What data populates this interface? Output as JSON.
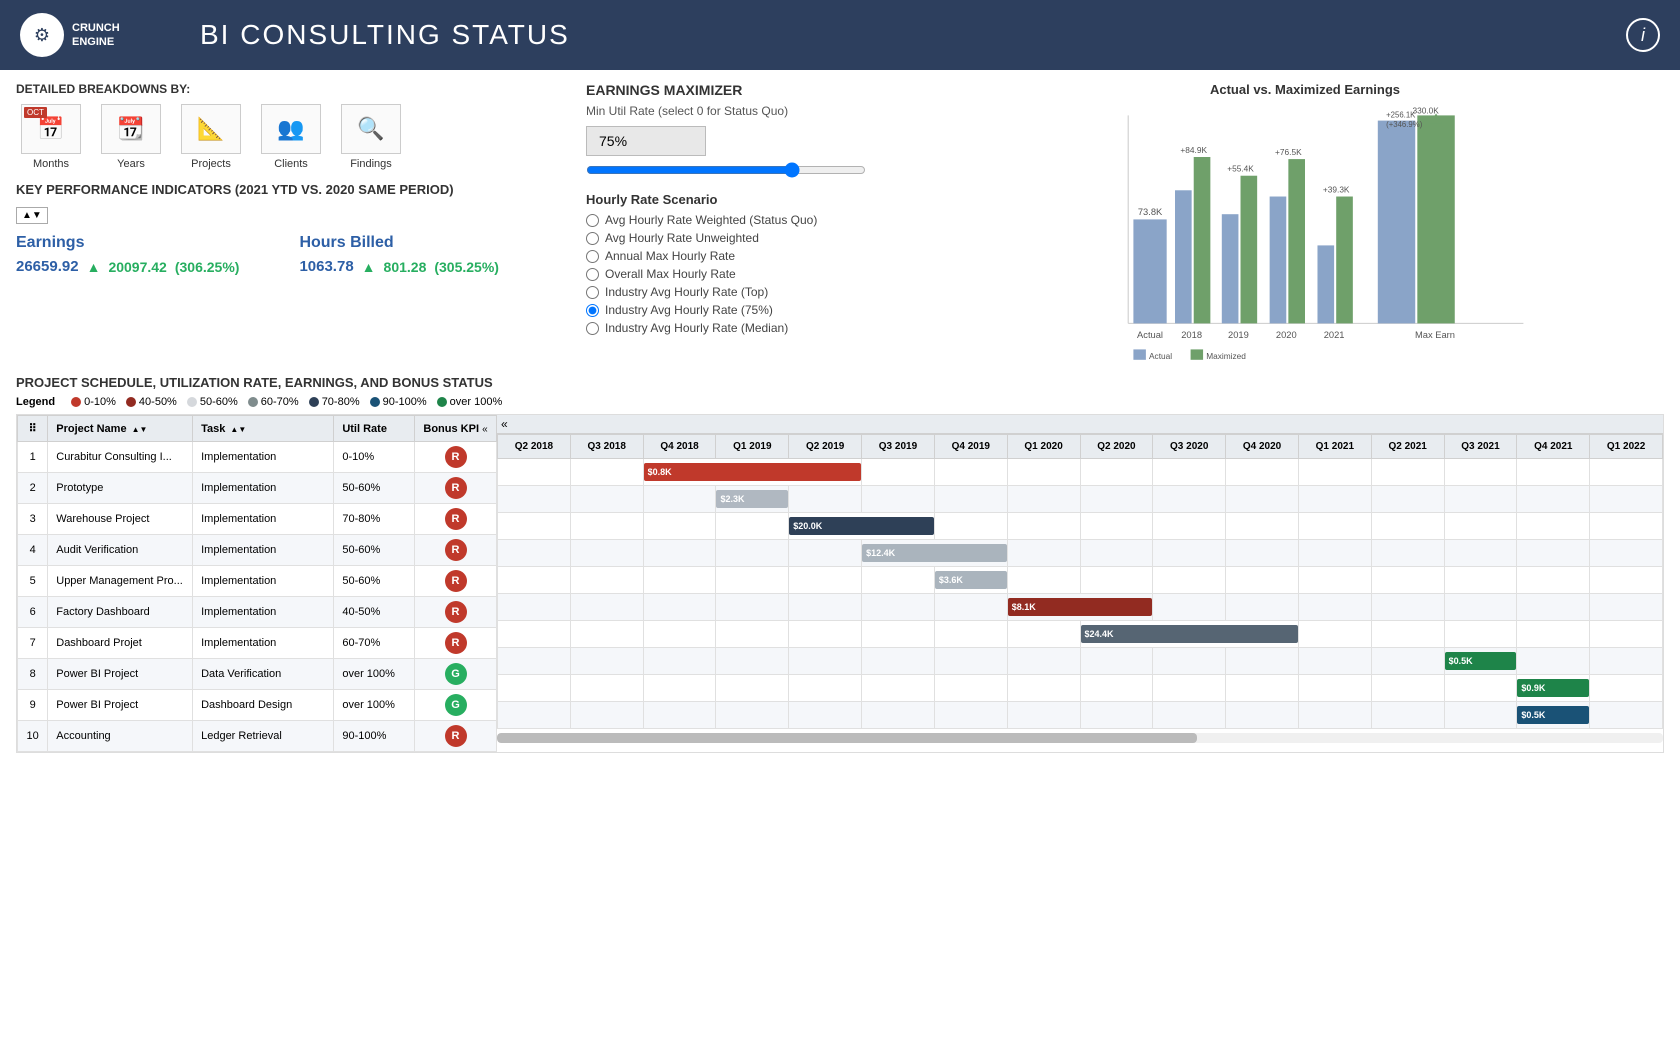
{
  "header": {
    "title": "BI CONSULTING STATUS",
    "logo_text": "CRUNCH\nENGINE",
    "info_icon": "i"
  },
  "breakdowns": {
    "label": "DETAILED BREAKDOWNS BY:",
    "items": [
      {
        "id": "months",
        "label": "Months",
        "badge": "OCT",
        "icon": "📅"
      },
      {
        "id": "years",
        "label": "Years",
        "icon": "📆"
      },
      {
        "id": "projects",
        "label": "Projects",
        "icon": "📐"
      },
      {
        "id": "clients",
        "label": "Clients",
        "icon": "👥"
      },
      {
        "id": "findings",
        "label": "Findings",
        "icon": "🔍"
      }
    ]
  },
  "kpi": {
    "title": "KEY PERFORMANCE INDICATORS (2021 YTD VS. 2020 SAME PERIOD)",
    "earnings": {
      "label": "Earnings",
      "main": "26659.92",
      "change": "20097.42",
      "pct": "(306.25%)"
    },
    "hours": {
      "label": "Hours Billed",
      "main": "1063.78",
      "change": "801.28",
      "pct": "(305.25%)"
    }
  },
  "maximizer": {
    "title": "EARNINGS MAXIMIZER",
    "subtitle": "Min Util Rate (select 0 for Status Quo)",
    "rate_value": "75%",
    "hourly_title": "Hourly Rate Scenario",
    "options": [
      {
        "label": "Avg Hourly Rate Weighted (Status Quo)",
        "checked": false
      },
      {
        "label": "Avg Hourly Rate Unweighted",
        "checked": false
      },
      {
        "label": "Annual Max Hourly Rate",
        "checked": false
      },
      {
        "label": "Overall Max Hourly Rate",
        "checked": false
      },
      {
        "label": "Industry Avg Hourly Rate (Top)",
        "checked": false
      },
      {
        "label": "Industry Avg Hourly Rate (75%)",
        "checked": true
      },
      {
        "label": "Industry Avg Hourly Rate (Median)",
        "checked": false
      }
    ]
  },
  "chart": {
    "title": "Actual vs. Maximized Earnings",
    "bars": [
      {
        "label": "Actual",
        "actual": 73.8,
        "max": null,
        "actual_label": "73.8K",
        "max_label": null,
        "diff": null
      },
      {
        "label": "2018",
        "actual": 84.9,
        "max": 84.9,
        "actual_label": "84.9K",
        "max_label": "+84.9K",
        "diff": null
      },
      {
        "label": "2019",
        "actual": 55.4,
        "max": 55.4,
        "actual_label": "55.4K",
        "max_label": "+55.4K",
        "diff": null
      },
      {
        "label": "2020",
        "actual": 76.5,
        "max": 76.5,
        "actual_label": "76.5K",
        "max_label": "+76.5K",
        "diff": null
      },
      {
        "label": "2021",
        "actual": 39.3,
        "max": 39.3,
        "actual_label": "39.3K",
        "max_label": "+39.3K",
        "diff": null
      },
      {
        "label": "Max Earn",
        "actual": 256.1,
        "max": 330.0,
        "actual_label": "256.1K (+346.9%)",
        "max_label": "330.0K",
        "diff": null
      }
    ]
  },
  "schedule": {
    "title": "PROJECT SCHEDULE, UTILIZATION RATE, EARNINGS, AND BONUS STATUS",
    "legend_items": [
      {
        "label": "0-10%",
        "color": "#c0392b"
      },
      {
        "label": "40-50%",
        "color": "#922b21"
      },
      {
        "label": "50-60%",
        "color": "#d5d8dc"
      },
      {
        "label": "60-70%",
        "color": "#7f8c8d"
      },
      {
        "label": "70-80%",
        "color": "#2e4057"
      },
      {
        "label": "90-100%",
        "color": "#1a5276"
      },
      {
        "label": "over 100%",
        "color": "#1e8449"
      }
    ],
    "columns": {
      "num": "#",
      "project": "Project Name",
      "task": "Task",
      "util": "Util Rate",
      "bonus": "Bonus KPI"
    },
    "rows": [
      {
        "num": 1,
        "project": "Curabitur Consulting I...",
        "task": "Implementation",
        "util": "0-10%",
        "bonus": "R",
        "gantt_col": 2,
        "gantt_width": 3,
        "gantt_color": "#c0392b",
        "gantt_label": "$0.8K"
      },
      {
        "num": 2,
        "project": "Prototype",
        "task": "Implementation",
        "util": "50-60%",
        "bonus": "R",
        "gantt_col": 3,
        "gantt_width": 1,
        "gantt_color": "#b0b8c1",
        "gantt_label": "$2.3K"
      },
      {
        "num": 3,
        "project": "Warehouse Project",
        "task": "Implementation",
        "util": "70-80%",
        "bonus": "R",
        "gantt_col": 4,
        "gantt_width": 2,
        "gantt_color": "#2e4057",
        "gantt_label": "$20.0K"
      },
      {
        "num": 4,
        "project": "Audit Verification",
        "task": "Implementation",
        "util": "50-60%",
        "bonus": "R",
        "gantt_col": 5,
        "gantt_width": 2,
        "gantt_color": "#aab4bd",
        "gantt_label": "$12.4K"
      },
      {
        "num": 5,
        "project": "Upper Management Pro...",
        "task": "Implementation",
        "util": "50-60%",
        "bonus": "R",
        "gantt_col": 6,
        "gantt_width": 1,
        "gantt_color": "#aab4bd",
        "gantt_label": "$3.6K"
      },
      {
        "num": 6,
        "project": "Factory Dashboard",
        "task": "Implementation",
        "util": "40-50%",
        "bonus": "R",
        "gantt_col": 7,
        "gantt_width": 2,
        "gantt_color": "#922b21",
        "gantt_label": "$8.1K"
      },
      {
        "num": 7,
        "project": "Dashboard Projet",
        "task": "Implementation",
        "util": "60-70%",
        "bonus": "R",
        "gantt_col": 8,
        "gantt_width": 3,
        "gantt_color": "#566573",
        "gantt_label": "$24.4K"
      },
      {
        "num": 8,
        "project": "Power BI Project",
        "task": "Data Verification",
        "util": "over 100%",
        "bonus": "G",
        "gantt_col": 9,
        "gantt_width": 1,
        "gantt_color": "#1e8449",
        "gantt_label": "$0.5K"
      },
      {
        "num": 9,
        "project": "Power BI Project",
        "task": "Dashboard Design",
        "util": "over 100%",
        "bonus": "G",
        "gantt_col": 10,
        "gantt_width": 1,
        "gantt_color": "#1e8449",
        "gantt_label": "$0.9K"
      },
      {
        "num": 10,
        "project": "Accounting",
        "task": "Ledger Retrieval",
        "util": "90-100%",
        "bonus": "R",
        "gantt_col": 10,
        "gantt_width": 1,
        "gantt_color": "#1a5276",
        "gantt_label": "$0.5K"
      }
    ],
    "gantt_headers": [
      "Q2 2018",
      "Q3 2018",
      "Q4 2018",
      "Q1 2019",
      "Q2 2019",
      "Q3 2019",
      "Q4 2019",
      "Q1 2020",
      "Q2 2020",
      "Q3 2020",
      "Q4 2020",
      "Q1 2021",
      "Q2 2021",
      "Q3 2021",
      "Q4 2021",
      "Q1 2022"
    ]
  }
}
